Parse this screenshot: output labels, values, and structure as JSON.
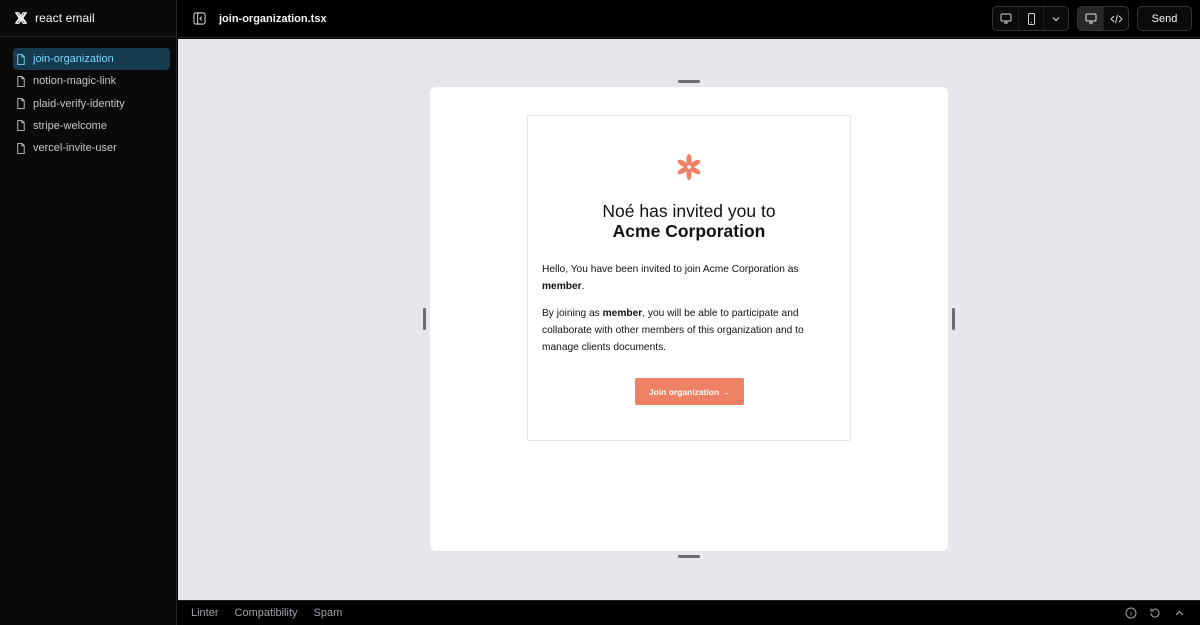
{
  "brand": {
    "name": "react email"
  },
  "sidebar": {
    "items": [
      {
        "label": "join-organization",
        "active": true
      },
      {
        "label": "notion-magic-link"
      },
      {
        "label": "plaid-verify-identity"
      },
      {
        "label": "stripe-welcome"
      },
      {
        "label": "vercel-invite-user"
      }
    ]
  },
  "topbar": {
    "current_file": "join-organization.tsx",
    "send_label": "Send"
  },
  "email": {
    "heading_line1": "Noé has invited you to",
    "heading_line2": "Acme Corporation",
    "p1_text": "Hello, You have been invited to join Acme Corporation as ",
    "p1_bold": "member",
    "p1_end": ".",
    "p2_start": "By joining as ",
    "p2_bold": "member",
    "p2_end": ", you will be able to participate and collaborate with other members of this organization and to manage clients documents.",
    "button_label": "Join organization →",
    "accent_color": "#ee8063"
  },
  "bottombar": {
    "tabs": [
      "Linter",
      "Compatibility",
      "Spam"
    ]
  }
}
